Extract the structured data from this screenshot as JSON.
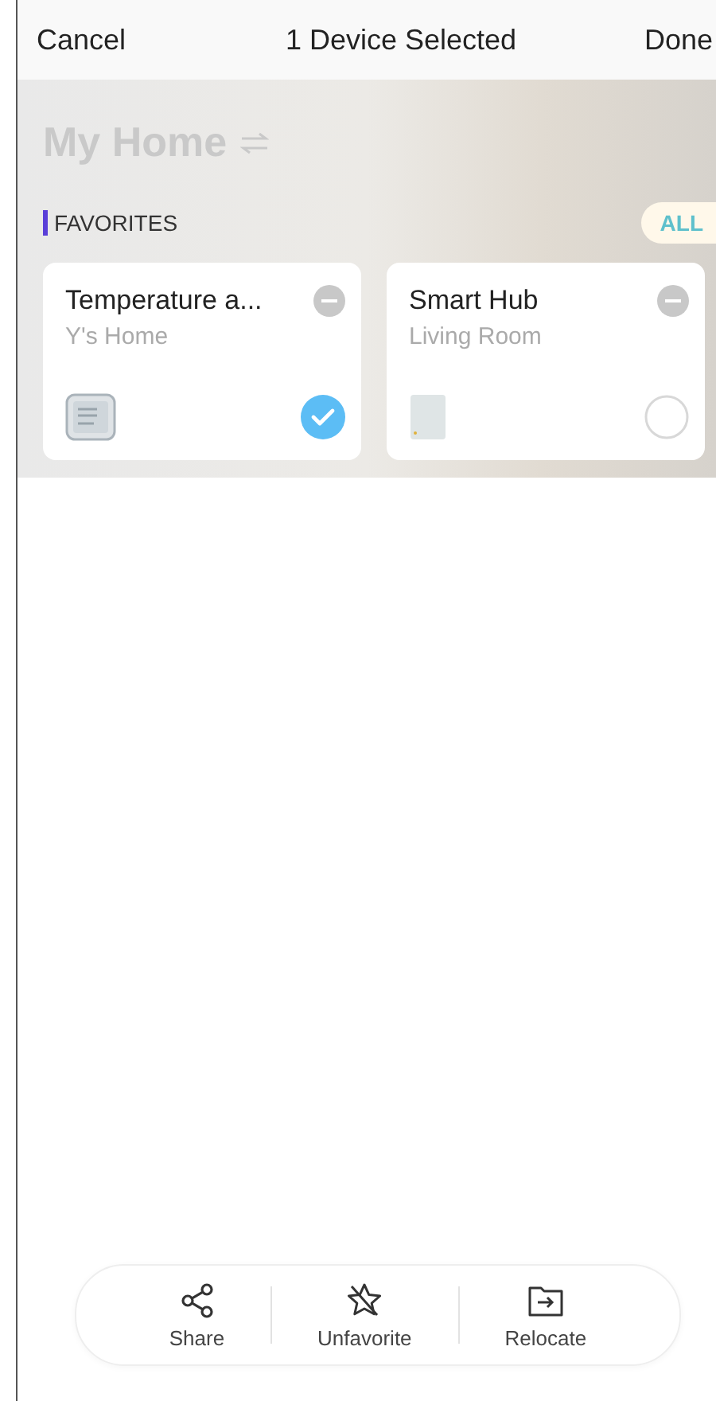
{
  "header": {
    "cancel": "Cancel",
    "title": "1 Device Selected",
    "done": "Done"
  },
  "home": {
    "title": "My Home",
    "section": "FAVORITES",
    "all_button": "ALL"
  },
  "devices": [
    {
      "name": "Temperature a...",
      "room": "Y's Home",
      "kind": "sensor",
      "selected": true
    },
    {
      "name": "Smart Hub",
      "room": "Living Room",
      "kind": "hub",
      "selected": false
    }
  ],
  "actions": [
    {
      "label": "Share",
      "kind": "share"
    },
    {
      "label": "Unfavorite",
      "kind": "unfavorite"
    },
    {
      "label": "Relocate",
      "kind": "relocate"
    }
  ]
}
